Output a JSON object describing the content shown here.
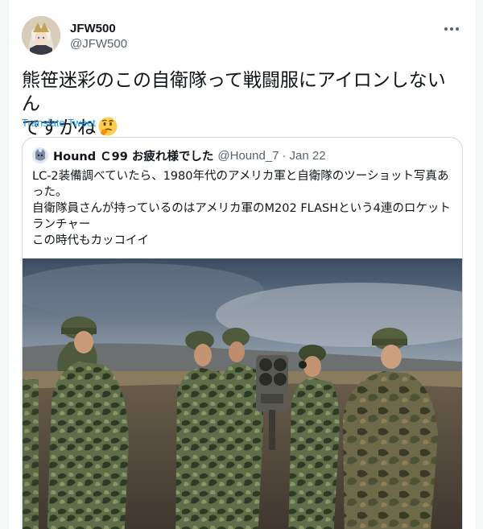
{
  "tweet": {
    "display_name": "JFW500",
    "handle": "@JFW500",
    "text_line1": "熊笹迷彩のこの自衛隊って戦闘服にアイロンしないん",
    "text_line2": "ですかね",
    "emoji": "thinking-face",
    "translate_label": "Translate Tweet",
    "more_icon": "more-horizontal-icon"
  },
  "quoted": {
    "display_name": "Hound Ｃ99 お疲れ様でした",
    "handle": "@Hound_7",
    "separator": "·",
    "date": "Jan 22",
    "lines": [
      "LC-2装備調べていたら、1980年代のアメリカ軍と自衛隊のツーショット写真あ",
      "った。",
      "自衛隊員さんが持っているのはアメリカ軍のM202 FLASHという4連のロケット",
      "ランチャー",
      "この時代もカッコイイ"
    ]
  },
  "colors": {
    "link": "#1d9bf0",
    "secondary_text": "#536471",
    "border": "#cfd9de",
    "text": "#0f1419"
  }
}
